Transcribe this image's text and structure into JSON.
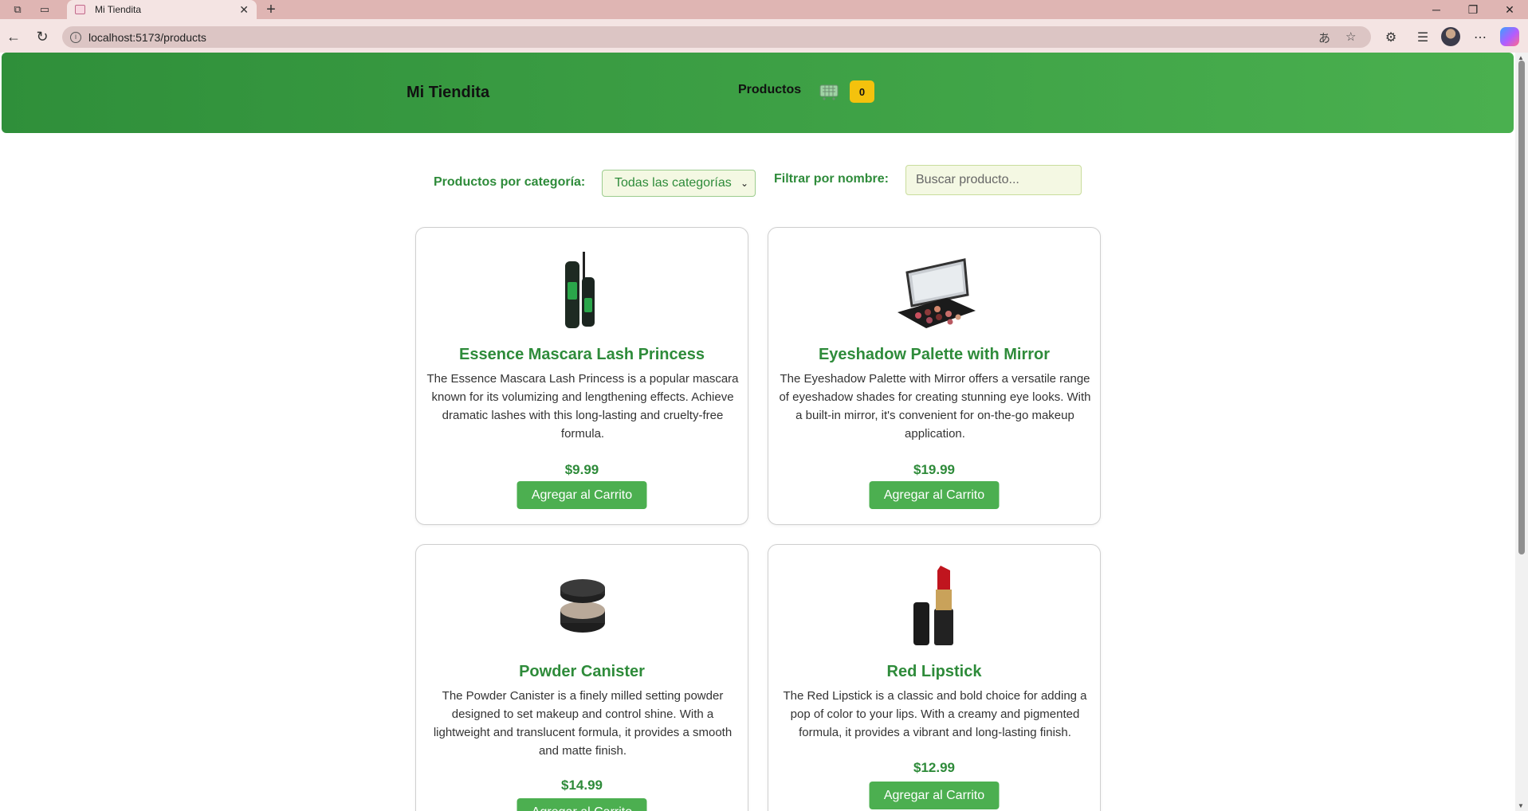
{
  "browser": {
    "tab_title": "Mi Tiendita",
    "tab_close": "✕",
    "new_tab": "+",
    "url": "localhost:5173/products",
    "window_controls": {
      "minimize": "─",
      "maximize": "❐",
      "close": "✕"
    }
  },
  "header": {
    "brand": "Mi Tiendita",
    "nav_products": "Productos",
    "cart_count": "0"
  },
  "filters": {
    "category_label": "Productos por categoría:",
    "category_selected": "Todas las categorías",
    "name_label": "Filtrar por nombre:",
    "search_placeholder": "Buscar producto..."
  },
  "products": [
    {
      "name": "Essence Mascara Lash Princess",
      "description": "The Essence Mascara Lash Princess is a popular mascara known for its volumizing and lengthening effects. Achieve dramatic lashes with this long-lasting and cruelty-free formula.",
      "price": "$9.99",
      "button": "Agregar al Carrito",
      "image_icon": "mascara-image"
    },
    {
      "name": "Eyeshadow Palette with Mirror",
      "description": "The Eyeshadow Palette with Mirror offers a versatile range of eyeshadow shades for creating stunning eye looks. With a built-in mirror, it's convenient for on-the-go makeup application.",
      "price": "$19.99",
      "button": "Agregar al Carrito",
      "image_icon": "eyeshadow-palette-image"
    },
    {
      "name": "Powder Canister",
      "description": "The Powder Canister is a finely milled setting powder designed to set makeup and control shine. With a lightweight and translucent formula, it provides a smooth and matte finish.",
      "price": "$14.99",
      "button": "Agregar al Carrito",
      "image_icon": "powder-canister-image"
    },
    {
      "name": "Red Lipstick",
      "description": "The Red Lipstick is a classic and bold choice for adding a pop of color to your lips. With a creamy and pigmented formula, it provides a vibrant and long-lasting finish.",
      "price": "$12.99",
      "button": "Agregar al Carrito",
      "image_icon": "red-lipstick-image"
    }
  ],
  "colors": {
    "accent_green": "#2e8b3a",
    "button_green": "#4caf50",
    "header_gradient_start": "#2f8f3a",
    "header_gradient_end": "#4ab04f",
    "badge_yellow": "#f4c20d",
    "browser_chrome": "#f4e4e3"
  }
}
